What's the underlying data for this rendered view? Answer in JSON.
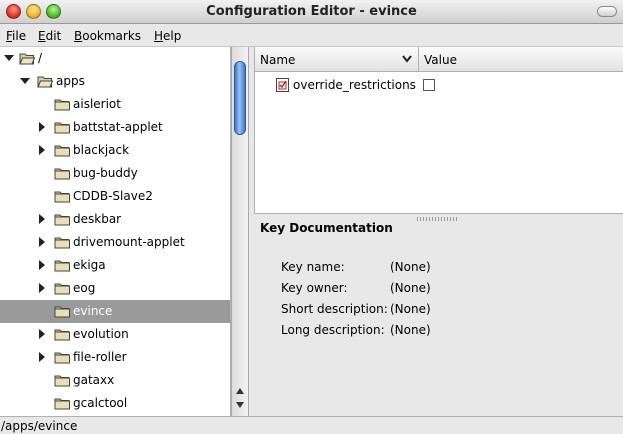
{
  "window": {
    "title": "Configuration Editor - evince"
  },
  "menu": [
    {
      "prefix": "",
      "mnemonic": "F",
      "rest": "ile"
    },
    {
      "prefix": "",
      "mnemonic": "E",
      "rest": "dit"
    },
    {
      "prefix": "",
      "mnemonic": "B",
      "rest": "ookmarks"
    },
    {
      "prefix": "",
      "mnemonic": "H",
      "rest": "elp"
    }
  ],
  "tree": {
    "root": "/",
    "apps": "apps",
    "items": [
      {
        "label": "aisleriot",
        "expandable": false,
        "selected": false
      },
      {
        "label": "battstat-applet",
        "expandable": true,
        "selected": false
      },
      {
        "label": "blackjack",
        "expandable": true,
        "selected": false
      },
      {
        "label": "bug-buddy",
        "expandable": false,
        "selected": false
      },
      {
        "label": "CDDB-Slave2",
        "expandable": false,
        "selected": false
      },
      {
        "label": "deskbar",
        "expandable": true,
        "selected": false
      },
      {
        "label": "drivemount-applet",
        "expandable": true,
        "selected": false
      },
      {
        "label": "ekiga",
        "expandable": true,
        "selected": false
      },
      {
        "label": "eog",
        "expandable": true,
        "selected": false
      },
      {
        "label": "evince",
        "expandable": false,
        "selected": true
      },
      {
        "label": "evolution",
        "expandable": true,
        "selected": false
      },
      {
        "label": "file-roller",
        "expandable": true,
        "selected": false
      },
      {
        "label": "gataxx",
        "expandable": false,
        "selected": false
      },
      {
        "label": "gcalctool",
        "expandable": false,
        "selected": false
      }
    ]
  },
  "list": {
    "columns": {
      "name": "Name",
      "value": "Value"
    },
    "keys": [
      {
        "name": "override_restrictions",
        "checked": false
      }
    ]
  },
  "doc": {
    "title": "Key Documentation",
    "fields": [
      {
        "label": "Key name:",
        "value": "(None)"
      },
      {
        "label": "Key owner:",
        "value": "(None)"
      },
      {
        "label": "Short description:",
        "value": "(None)"
      },
      {
        "label": "Long description:",
        "value": "(None)"
      }
    ]
  },
  "status": {
    "path": "/apps/evince"
  },
  "colors": {
    "selection": "#9a9a9a",
    "scroll_thumb": "#3f76c8"
  }
}
